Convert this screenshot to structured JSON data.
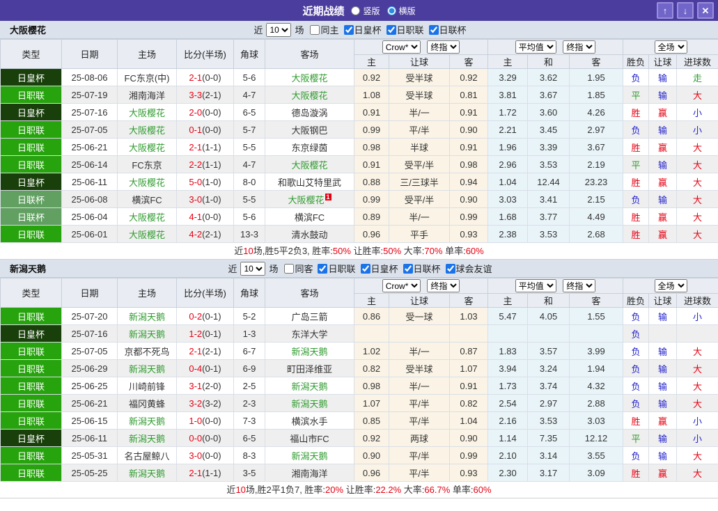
{
  "header": {
    "title": "近期战绩",
    "radio_vertical": "竖版",
    "radio_horizontal": "横版",
    "up_icon": "↑",
    "down_icon": "↓",
    "close_icon": "✕"
  },
  "colors": {
    "accent_purple": "#4b3d9e",
    "cup_badge_green": "#193f0b",
    "league_badge_green": "#27a30d",
    "league_cup_badge_green": "#61a061",
    "focus_team_green": "#2f9b2f",
    "win_red": "#e60012",
    "lose_blue": "#2222cc",
    "handicap_bg": "#fbf4e6",
    "average_bg": "#e9f4f9"
  },
  "columns": {
    "type": "类型",
    "date": "日期",
    "home": "主场",
    "score": "比分(半场)",
    "corner": "角球",
    "away": "客场",
    "sub": [
      "主",
      "让球",
      "客",
      "主",
      "和",
      "客",
      "胜负",
      "让球",
      "进球数"
    ]
  },
  "sections": [
    {
      "team": "大阪樱花",
      "filters": {
        "prefix": "近",
        "count": "10",
        "suffix": "场",
        "same_label": "同主",
        "same_checked": false,
        "leagues": [
          {
            "label": "日皇杯",
            "checked": true
          },
          {
            "label": "日职联",
            "checked": true
          },
          {
            "label": "日联杯",
            "checked": true
          }
        ]
      },
      "dropdowns": {
        "company": "Crow*",
        "company_stage": "终指",
        "avg": "平均值",
        "avg_stage": "终指",
        "scope": "全场"
      },
      "rows": [
        {
          "tc": "cup",
          "type": "日皇杯",
          "date": "25-08-06",
          "home": "FC东京(中)",
          "hf": false,
          "ft": "2-1",
          "ht": "(0-0)",
          "corner": "5-6",
          "away": "大阪樱花",
          "af": true,
          "o1": "0.92",
          "line": "受半球",
          "o2": "0.92",
          "e1": "3.29",
          "e2": "3.62",
          "e3": "1.95",
          "r1": {
            "t": "负",
            "c": "b"
          },
          "r2": {
            "t": "输",
            "c": "b"
          },
          "r3": {
            "t": "走",
            "c": "g"
          }
        },
        {
          "tc": "jl",
          "type": "日职联",
          "date": "25-07-19",
          "home": "湘南海洋",
          "hf": false,
          "ft": "3-3",
          "ht": "(2-1)",
          "corner": "4-7",
          "away": "大阪樱花",
          "af": true,
          "o1": "1.08",
          "line": "受半球",
          "o2": "0.81",
          "e1": "3.81",
          "e2": "3.67",
          "e3": "1.85",
          "r1": {
            "t": "平",
            "c": "g"
          },
          "r2": {
            "t": "输",
            "c": "b"
          },
          "r3": {
            "t": "大",
            "c": "r"
          }
        },
        {
          "tc": "cup",
          "type": "日皇杯",
          "date": "25-07-16",
          "home": "大阪樱花",
          "hf": true,
          "ft": "2-0",
          "ht": "(0-0)",
          "corner": "6-5",
          "away": "德岛漩涡",
          "af": false,
          "o1": "0.91",
          "line": "半/一",
          "o2": "0.91",
          "e1": "1.72",
          "e2": "3.60",
          "e3": "4.26",
          "r1": {
            "t": "胜",
            "c": "r"
          },
          "r2": {
            "t": "赢",
            "c": "r"
          },
          "r3": {
            "t": "小",
            "c": "b"
          }
        },
        {
          "tc": "jl",
          "type": "日职联",
          "date": "25-07-05",
          "home": "大阪樱花",
          "hf": true,
          "ft": "0-1",
          "ht": "(0-0)",
          "corner": "5-7",
          "away": "大阪钢巴",
          "af": false,
          "o1": "0.99",
          "line": "平/半",
          "o2": "0.90",
          "e1": "2.21",
          "e2": "3.45",
          "e3": "2.97",
          "r1": {
            "t": "负",
            "c": "b"
          },
          "r2": {
            "t": "输",
            "c": "b"
          },
          "r3": {
            "t": "小",
            "c": "b"
          }
        },
        {
          "tc": "jl",
          "type": "日职联",
          "date": "25-06-21",
          "home": "大阪樱花",
          "hf": true,
          "ft": "2-1",
          "ht": "(1-1)",
          "corner": "5-5",
          "away": "东京绿茵",
          "af": false,
          "o1": "0.98",
          "line": "半球",
          "o2": "0.91",
          "e1": "1.96",
          "e2": "3.39",
          "e3": "3.67",
          "r1": {
            "t": "胜",
            "c": "r"
          },
          "r2": {
            "t": "赢",
            "c": "r"
          },
          "r3": {
            "t": "大",
            "c": "r"
          }
        },
        {
          "tc": "jl",
          "type": "日职联",
          "date": "25-06-14",
          "home": "FC东京",
          "hf": false,
          "ft": "2-2",
          "ht": "(1-1)",
          "corner": "4-7",
          "away": "大阪樱花",
          "af": true,
          "o1": "0.91",
          "line": "受平/半",
          "o2": "0.98",
          "e1": "2.96",
          "e2": "3.53",
          "e3": "2.19",
          "r1": {
            "t": "平",
            "c": "g"
          },
          "r2": {
            "t": "输",
            "c": "b"
          },
          "r3": {
            "t": "大",
            "c": "r"
          }
        },
        {
          "tc": "cup",
          "type": "日皇杯",
          "date": "25-06-11",
          "home": "大阪樱花",
          "hf": true,
          "ft": "5-0",
          "ht": "(1-0)",
          "corner": "8-0",
          "away": "和歌山艾特里武",
          "af": false,
          "o1": "0.88",
          "line": "三/三球半",
          "o2": "0.94",
          "e1": "1.04",
          "e2": "12.44",
          "e3": "23.23",
          "r1": {
            "t": "胜",
            "c": "r"
          },
          "r2": {
            "t": "赢",
            "c": "r"
          },
          "r3": {
            "t": "大",
            "c": "r"
          }
        },
        {
          "tc": "lc",
          "type": "日联杯",
          "date": "25-06-08",
          "home": "横滨FC",
          "hf": false,
          "ft": "3-0",
          "ht": "(1-0)",
          "corner": "5-5",
          "away": "大阪樱花",
          "af": true,
          "badge": "1",
          "o1": "0.99",
          "line": "受平/半",
          "o2": "0.90",
          "e1": "3.03",
          "e2": "3.41",
          "e3": "2.15",
          "r1": {
            "t": "负",
            "c": "b"
          },
          "r2": {
            "t": "输",
            "c": "b"
          },
          "r3": {
            "t": "大",
            "c": "r"
          }
        },
        {
          "tc": "lc",
          "type": "日联杯",
          "date": "25-06-04",
          "home": "大阪樱花",
          "hf": true,
          "ft": "4-1",
          "ht": "(0-0)",
          "corner": "5-6",
          "away": "横滨FC",
          "af": false,
          "o1": "0.89",
          "line": "半/一",
          "o2": "0.99",
          "e1": "1.68",
          "e2": "3.77",
          "e3": "4.49",
          "r1": {
            "t": "胜",
            "c": "r"
          },
          "r2": {
            "t": "赢",
            "c": "r"
          },
          "r3": {
            "t": "大",
            "c": "r"
          }
        },
        {
          "tc": "jl",
          "type": "日职联",
          "date": "25-06-01",
          "home": "大阪樱花",
          "hf": true,
          "ft": "4-2",
          "ht": "(2-1)",
          "corner": "13-3",
          "away": "清水鼓动",
          "af": false,
          "o1": "0.96",
          "line": "平手",
          "o2": "0.93",
          "e1": "2.38",
          "e2": "3.53",
          "e3": "2.68",
          "r1": {
            "t": "胜",
            "c": "r"
          },
          "r2": {
            "t": "赢",
            "c": "r"
          },
          "r3": {
            "t": "大",
            "c": "r"
          }
        }
      ],
      "summary_parts": [
        {
          "t": "近",
          "r": false
        },
        {
          "t": "10",
          "r": true
        },
        {
          "t": "场,胜5平2负3, 胜率:",
          "r": false
        },
        {
          "t": "50%",
          "r": true
        },
        {
          "t": " 让胜率:",
          "r": false
        },
        {
          "t": "50%",
          "r": true
        },
        {
          "t": " 大率:",
          "r": false
        },
        {
          "t": "70%",
          "r": true
        },
        {
          "t": " 单率:",
          "r": false
        },
        {
          "t": "60%",
          "r": true
        }
      ]
    },
    {
      "team": "新潟天鹅",
      "filters": {
        "prefix": "近",
        "count": "10",
        "suffix": "场",
        "same_label": "同客",
        "same_checked": false,
        "leagues": [
          {
            "label": "日职联",
            "checked": true
          },
          {
            "label": "日皇杯",
            "checked": true
          },
          {
            "label": "日联杯",
            "checked": true
          },
          {
            "label": "球会友谊",
            "checked": true
          }
        ]
      },
      "dropdowns": {
        "company": "Crow*",
        "company_stage": "终指",
        "avg": "平均值",
        "avg_stage": "终指",
        "scope": "全场"
      },
      "rows": [
        {
          "tc": "jl",
          "type": "日职联",
          "date": "25-07-20",
          "home": "新潟天鹅",
          "hf": true,
          "ft": "0-2",
          "ht": "(0-1)",
          "corner": "5-2",
          "away": "广岛三箭",
          "af": false,
          "o1": "0.86",
          "line": "受一球",
          "o2": "1.03",
          "e1": "5.47",
          "e2": "4.05",
          "e3": "1.55",
          "r1": {
            "t": "负",
            "c": "b"
          },
          "r2": {
            "t": "输",
            "c": "b"
          },
          "r3": {
            "t": "小",
            "c": "b"
          }
        },
        {
          "tc": "cup",
          "type": "日皇杯",
          "date": "25-07-16",
          "home": "新潟天鹅",
          "hf": true,
          "ft": "1-2",
          "ht": "(0-1)",
          "corner": "1-3",
          "away": "东洋大学",
          "af": false,
          "o1": "",
          "line": "",
          "o2": "",
          "e1": "",
          "e2": "",
          "e3": "",
          "r1": {
            "t": "负",
            "c": "b"
          },
          "r2": {
            "t": "",
            "c": "b"
          },
          "r3": {
            "t": "",
            "c": "b"
          }
        },
        {
          "tc": "jl",
          "type": "日职联",
          "date": "25-07-05",
          "home": "京都不死鸟",
          "hf": false,
          "ft": "2-1",
          "ht": "(2-1)",
          "corner": "6-7",
          "away": "新潟天鹅",
          "af": true,
          "o1": "1.02",
          "line": "半/一",
          "o2": "0.87",
          "e1": "1.83",
          "e2": "3.57",
          "e3": "3.99",
          "r1": {
            "t": "负",
            "c": "b"
          },
          "r2": {
            "t": "输",
            "c": "b"
          },
          "r3": {
            "t": "大",
            "c": "r"
          }
        },
        {
          "tc": "jl",
          "type": "日职联",
          "date": "25-06-29",
          "home": "新潟天鹅",
          "hf": true,
          "ft": "0-4",
          "ht": "(0-1)",
          "corner": "6-9",
          "away": "町田泽维亚",
          "af": false,
          "o1": "0.82",
          "line": "受半球",
          "o2": "1.07",
          "e1": "3.94",
          "e2": "3.24",
          "e3": "1.94",
          "r1": {
            "t": "负",
            "c": "b"
          },
          "r2": {
            "t": "输",
            "c": "b"
          },
          "r3": {
            "t": "大",
            "c": "r"
          }
        },
        {
          "tc": "jl",
          "type": "日职联",
          "date": "25-06-25",
          "home": "川崎前锋",
          "hf": false,
          "ft": "3-1",
          "ht": "(2-0)",
          "corner": "2-5",
          "away": "新潟天鹅",
          "af": true,
          "o1": "0.98",
          "line": "半/一",
          "o2": "0.91",
          "e1": "1.73",
          "e2": "3.74",
          "e3": "4.32",
          "r1": {
            "t": "负",
            "c": "b"
          },
          "r2": {
            "t": "输",
            "c": "b"
          },
          "r3": {
            "t": "大",
            "c": "r"
          }
        },
        {
          "tc": "jl",
          "type": "日职联",
          "date": "25-06-21",
          "home": "福冈黄蜂",
          "hf": false,
          "ft": "3-2",
          "ht": "(3-2)",
          "corner": "2-3",
          "away": "新潟天鹅",
          "af": true,
          "o1": "1.07",
          "line": "平/半",
          "o2": "0.82",
          "e1": "2.54",
          "e2": "2.97",
          "e3": "2.88",
          "r1": {
            "t": "负",
            "c": "b"
          },
          "r2": {
            "t": "输",
            "c": "b"
          },
          "r3": {
            "t": "大",
            "c": "r"
          }
        },
        {
          "tc": "jl",
          "type": "日职联",
          "date": "25-06-15",
          "home": "新潟天鹅",
          "hf": true,
          "ft": "1-0",
          "ht": "(0-0)",
          "corner": "7-3",
          "away": "横滨水手",
          "af": false,
          "o1": "0.85",
          "line": "平/半",
          "o2": "1.04",
          "e1": "2.16",
          "e2": "3.53",
          "e3": "3.03",
          "r1": {
            "t": "胜",
            "c": "r"
          },
          "r2": {
            "t": "赢",
            "c": "r"
          },
          "r3": {
            "t": "小",
            "c": "b"
          }
        },
        {
          "tc": "cup",
          "type": "日皇杯",
          "date": "25-06-11",
          "home": "新潟天鹅",
          "hf": true,
          "ft": "0-0",
          "ht": "(0-0)",
          "corner": "6-5",
          "away": "福山市FC",
          "af": false,
          "o1": "0.92",
          "line": "两球",
          "o2": "0.90",
          "e1": "1.14",
          "e2": "7.35",
          "e3": "12.12",
          "r1": {
            "t": "平",
            "c": "g"
          },
          "r2": {
            "t": "输",
            "c": "b"
          },
          "r3": {
            "t": "小",
            "c": "b"
          }
        },
        {
          "tc": "jl",
          "type": "日职联",
          "date": "25-05-31",
          "home": "名古屋鲸八",
          "hf": false,
          "ft": "3-0",
          "ht": "(0-0)",
          "corner": "8-3",
          "away": "新潟天鹅",
          "af": true,
          "o1": "0.90",
          "line": "平/半",
          "o2": "0.99",
          "e1": "2.10",
          "e2": "3.14",
          "e3": "3.55",
          "r1": {
            "t": "负",
            "c": "b"
          },
          "r2": {
            "t": "输",
            "c": "b"
          },
          "r3": {
            "t": "大",
            "c": "r"
          }
        },
        {
          "tc": "jl",
          "type": "日职联",
          "date": "25-05-25",
          "home": "新潟天鹅",
          "hf": true,
          "ft": "2-1",
          "ht": "(1-1)",
          "corner": "3-5",
          "away": "湘南海洋",
          "af": false,
          "o1": "0.96",
          "line": "平/半",
          "o2": "0.93",
          "e1": "2.30",
          "e2": "3.17",
          "e3": "3.09",
          "r1": {
            "t": "胜",
            "c": "r"
          },
          "r2": {
            "t": "赢",
            "c": "r"
          },
          "r3": {
            "t": "大",
            "c": "r"
          }
        }
      ],
      "summary_parts": [
        {
          "t": "近",
          "r": false
        },
        {
          "t": "10",
          "r": true
        },
        {
          "t": "场,胜2平1负7, 胜率:",
          "r": false
        },
        {
          "t": "20%",
          "r": true
        },
        {
          "t": " 让胜率:",
          "r": false
        },
        {
          "t": "22.2%",
          "r": true
        },
        {
          "t": " 大率:",
          "r": false
        },
        {
          "t": "66.7%",
          "r": true
        },
        {
          "t": " 单率:",
          "r": false
        },
        {
          "t": "60%",
          "r": true
        }
      ]
    }
  ]
}
